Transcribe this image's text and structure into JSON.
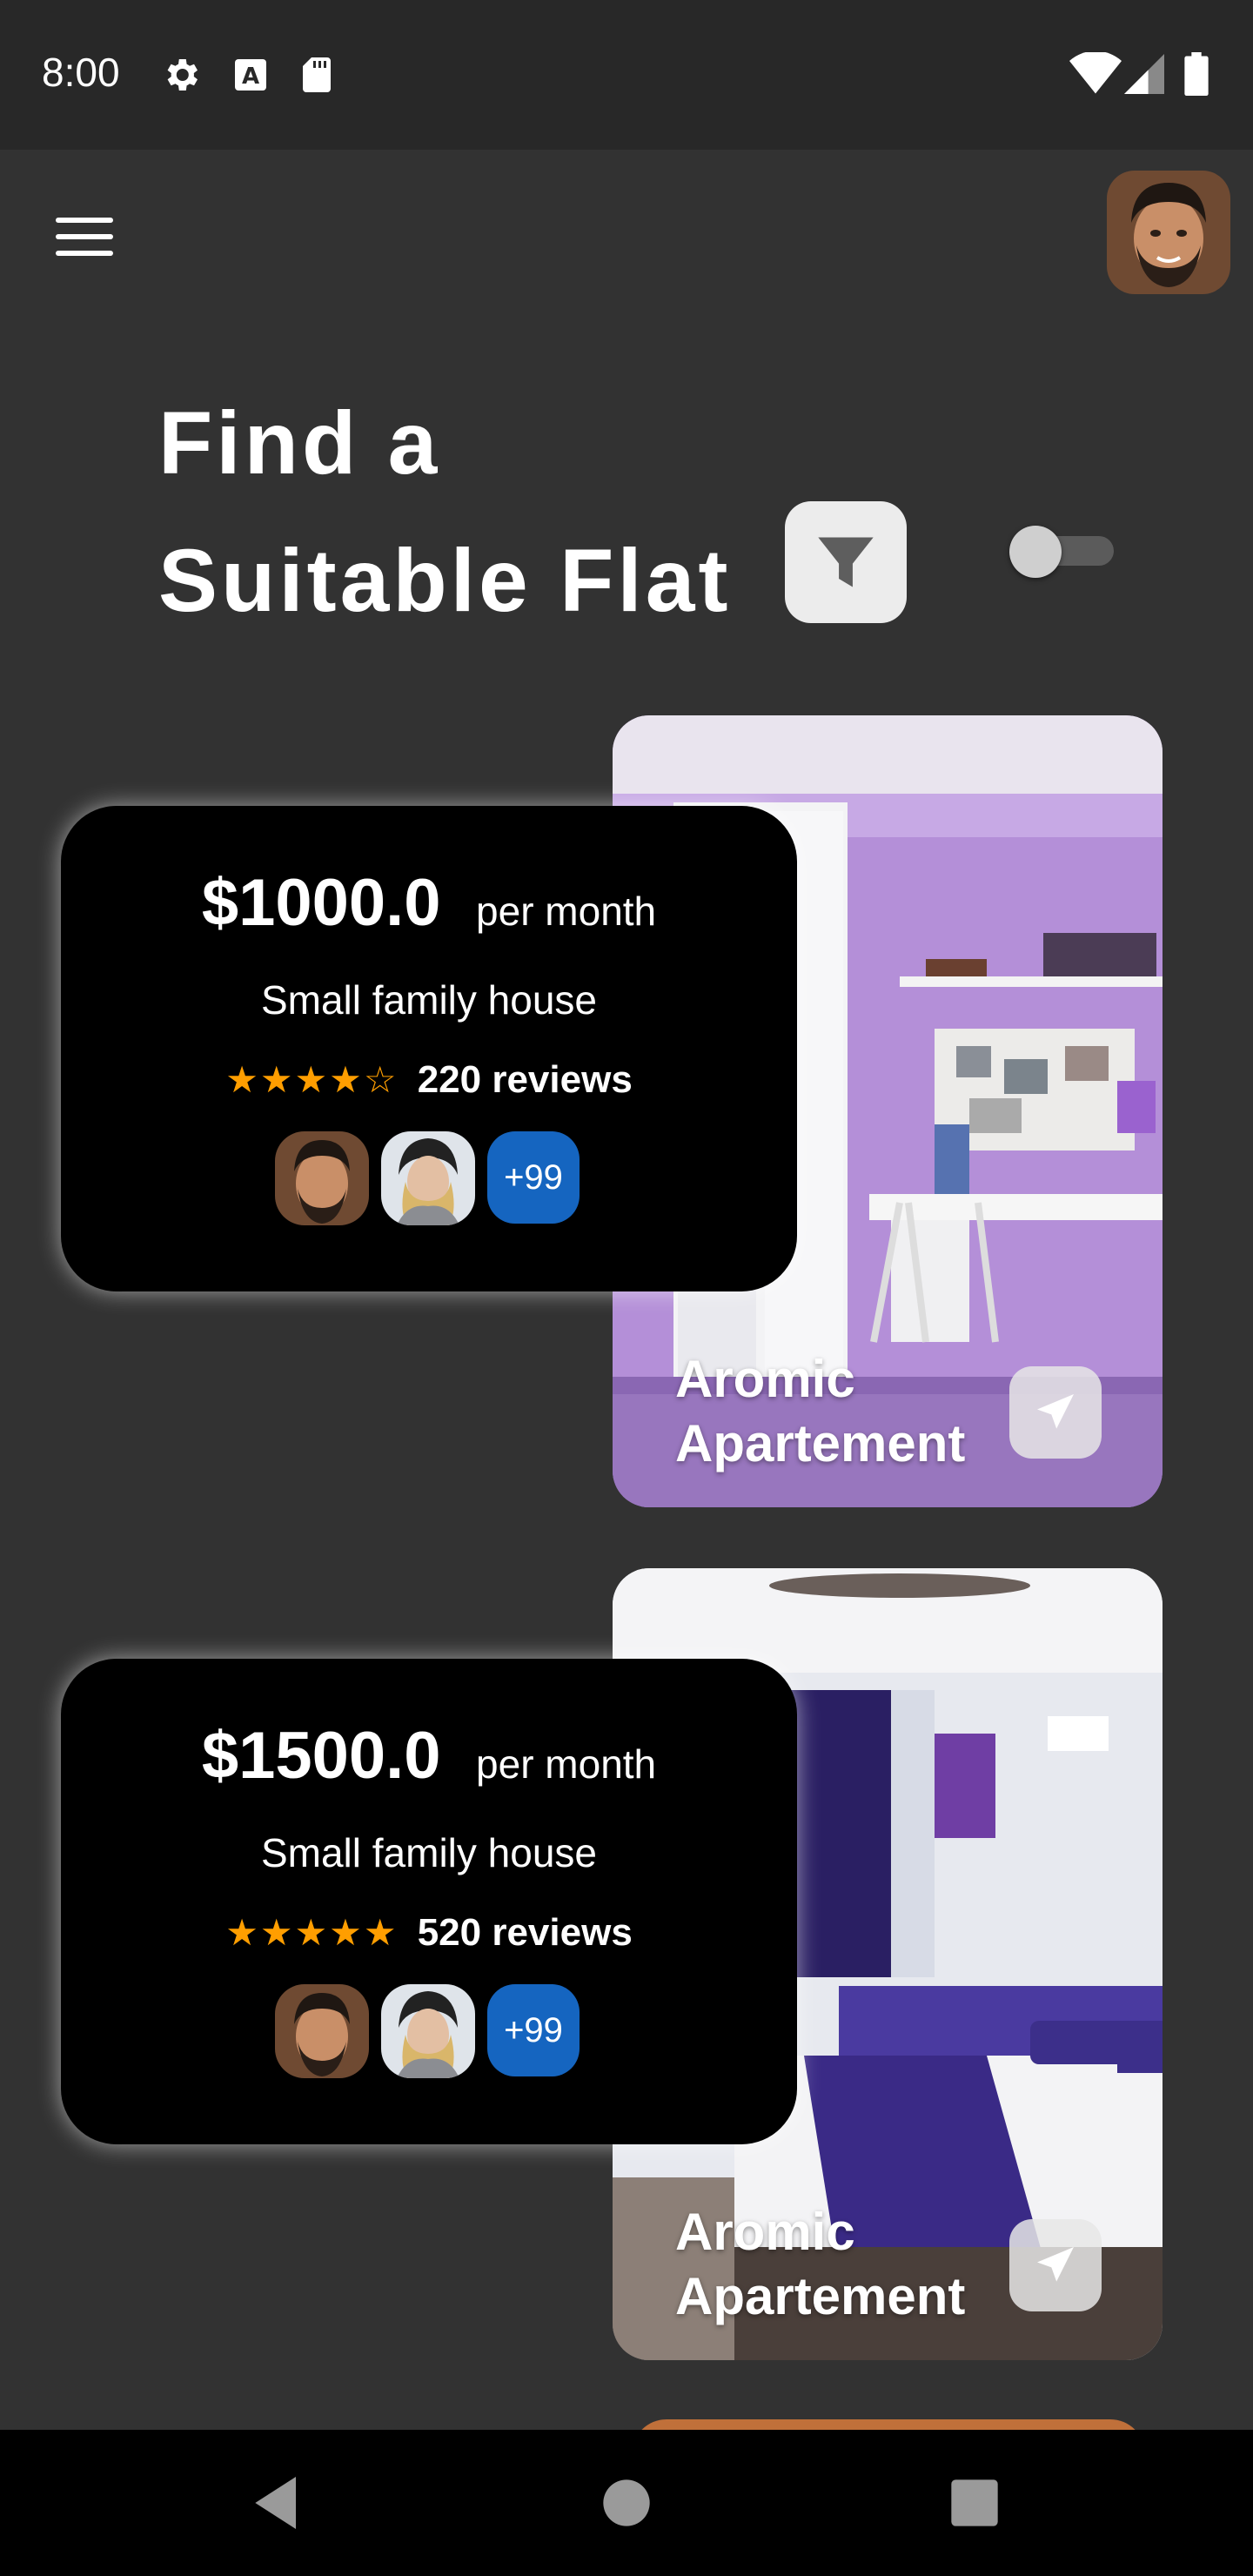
{
  "status_bar": {
    "time": "8:00",
    "icons_left": [
      "gear-icon",
      "font-a-icon",
      "sd-card-icon"
    ],
    "icons_right": [
      "wifi-icon",
      "signal-icon",
      "battery-icon"
    ]
  },
  "header": {
    "menu_icon": "hamburger-menu-icon",
    "title_line1": "Find a",
    "title_line2": "Suitable Flat",
    "filter_icon": "filter-icon",
    "toggle_on": false
  },
  "listings": [
    {
      "price": "$1000.0",
      "period": "per month",
      "type": "Small family house",
      "stars_text": "★★★★☆",
      "rating": 4,
      "reviews": "220 reviews",
      "more": "+99",
      "name": "Aromic\nApartement",
      "room_color": "purple-bedroom"
    },
    {
      "price": "$1500.0",
      "period": "per month",
      "type": "Small family house",
      "stars_text": "★★★★★",
      "rating": 5,
      "reviews": "520 reviews",
      "more": "+99",
      "name": "Aromic\nApartement",
      "room_color": "hotel-bedroom"
    }
  ],
  "colors": {
    "background": "#323232",
    "card": "#000000",
    "star": "#ff9e00",
    "badge": "#1565c0"
  },
  "nav_bar": {
    "items": [
      "back-icon",
      "home-icon",
      "recents-icon"
    ]
  }
}
